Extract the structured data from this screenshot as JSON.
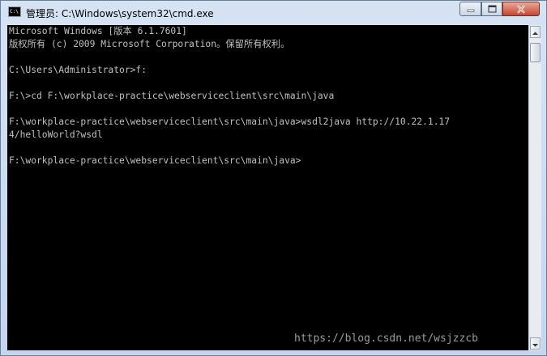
{
  "window": {
    "title": "管理员: C:\\Windows\\system32\\cmd.exe",
    "icon": "cmd-icon",
    "icon_text": "C:\\"
  },
  "console": {
    "lines": [
      "Microsoft Windows [版本 6.1.7601]",
      "版权所有 (c) 2009 Microsoft Corporation。保留所有权利。",
      "",
      "C:\\Users\\Administrator>f:",
      "",
      "F:\\>cd F:\\workplace-practice\\webserviceclient\\src\\main\\java",
      "",
      "F:\\workplace-practice\\webserviceclient\\src\\main\\java>wsdl2java http://10.22.1.17",
      "4/helloWorld?wsdl",
      "",
      "F:\\workplace-practice\\webserviceclient\\src\\main\\java>"
    ]
  },
  "watermark": "https://blog.csdn.net/wsjzzcb",
  "colors": {
    "console_bg": "#000000",
    "console_text": "#c0c0c0",
    "close_button": "#c7452f"
  }
}
